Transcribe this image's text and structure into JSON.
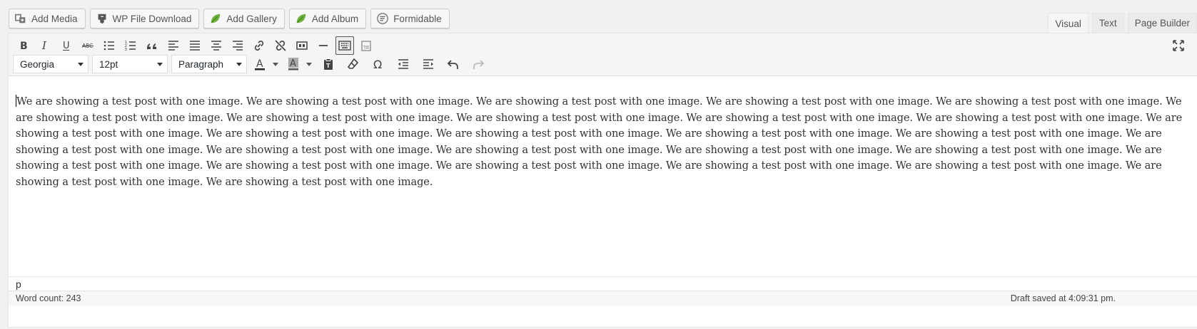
{
  "media_buttons": [
    {
      "label": "Add Media",
      "icon": "media-icon"
    },
    {
      "label": "WP File Download",
      "icon": "download-icon"
    },
    {
      "label": "Add Gallery",
      "icon": "leaf-icon"
    },
    {
      "label": "Add Album",
      "icon": "leaf-icon"
    },
    {
      "label": "Formidable",
      "icon": "formidable-icon"
    }
  ],
  "tabs": [
    {
      "label": "Visual",
      "active": true
    },
    {
      "label": "Text",
      "active": false
    },
    {
      "label": "Page Builder",
      "active": false
    }
  ],
  "toolbar": {
    "row1_icons": [
      "bold-icon",
      "italic-icon",
      "underline-icon",
      "strikethrough-icon",
      "bullet-list-icon",
      "numbered-list-icon",
      "blockquote-icon",
      "align-left-icon",
      "align-justify-icon",
      "align-center-icon",
      "align-right-icon",
      "link-icon",
      "unlink-icon",
      "insert-more-icon",
      "horizontal-rule-icon",
      "toolbar-toggle-icon",
      "paste-text-icon"
    ],
    "font_family": "Georgia",
    "font_size": "12pt",
    "format": "Paragraph",
    "text_color": "#23282d",
    "bg_color": "#555555",
    "row2_icons": [
      "paste-clipboard-icon",
      "clear-formatting-icon",
      "special-character-icon",
      "outdent-icon",
      "indent-icon",
      "undo-icon",
      "redo-icon"
    ]
  },
  "content": {
    "text": "We are showing a test post with one image. We are showing a test post with one image. We are showing a test post with one image. We are showing a test post with one image. We are showing a test post with one image. We are showing a test post with one image. We are showing a test post with one image. We are showing a test post with one image. We are showing a test post with one image. We are showing a test post with one image. We are showing a test post with one image. We are showing a test post with one image. We are showing a test post with one image. We are showing a test post with one image. We are showing a test post with one image. We are showing a test post with one image. We are showing a test post with one image. We are showing a test post with one image. We are showing a test post with one image. We are showing a test post with one image. We are showing a test post with one image. We are showing a test post with one image. We are showing a test post with one image. We are showing a test post with one image. We are showing a test post with one image. We are showing a test post with one image. We are showing a test post with one image."
  },
  "status": {
    "path": "p",
    "word_count": "Word count: 243",
    "saved": "Draft saved at 4:09:31 pm."
  }
}
